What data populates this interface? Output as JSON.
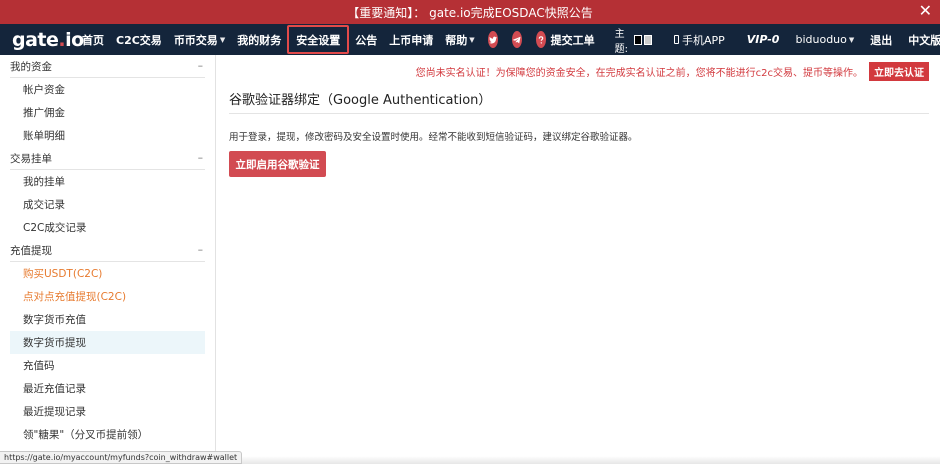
{
  "notice": {
    "text": "【重要通知】：  gate.io完成EOSDAC快照公告",
    "close": "✕"
  },
  "navbar": {
    "logo_main": "gate",
    "logo_dot": ".",
    "logo_tail": "io",
    "items": [
      {
        "label": "首页"
      },
      {
        "label": "C2C交易"
      },
      {
        "label": "币币交易",
        "dropdown": true
      },
      {
        "label": "我的财务"
      },
      {
        "label": "安全设置",
        "active": true
      },
      {
        "label": "公告"
      },
      {
        "label": "上币申请"
      },
      {
        "label": "帮助",
        "dropdown": true
      }
    ],
    "ticket": "提交工单",
    "theme_label": "主题:",
    "mobile_app": "手机APP",
    "vip": "VIP-0",
    "username": "biduoduo",
    "logout": "退出",
    "language": "中文版",
    "chevron": "▼",
    "accent": "#d24b52",
    "bg": "#14253b"
  },
  "sidebar": {
    "groups": [
      {
        "title": "我的资金",
        "toggle": "–",
        "items": [
          {
            "label": "帐户资金"
          },
          {
            "label": "推广佣金"
          },
          {
            "label": "账单明细"
          }
        ]
      },
      {
        "title": "交易挂单",
        "toggle": "–",
        "items": [
          {
            "label": "我的挂单"
          },
          {
            "label": "成交记录"
          },
          {
            "label": "C2C成交记录"
          }
        ]
      },
      {
        "title": "充值提现",
        "toggle": "–",
        "items": [
          {
            "label": "购买USDT(C2C)",
            "orange": true
          },
          {
            "label": "点对点充值提现(C2C)",
            "orange": true
          },
          {
            "label": "数字货币充值"
          },
          {
            "label": "数字货币提现",
            "selected": true
          },
          {
            "label": "充值码"
          },
          {
            "label": "最近充值记录"
          },
          {
            "label": "最近提现记录"
          },
          {
            "label": "领\"糖果\"（分叉币提前领）"
          }
        ]
      }
    ]
  },
  "main": {
    "warning": "您尚未实名认证！为保障您的资金安全，在完成实名认证之前，您将不能进行c2c交易、提币等操作。",
    "warning_button": "立即去认证",
    "title": "谷歌验证器绑定（Google Authentication）",
    "description": "用于登录，提现，修改密码及安全设置时使用。经常不能收到短信验证码，建议绑定谷歌验证器。",
    "enable_button": "立即启用谷歌验证"
  },
  "statusbar": {
    "url": "https://gate.io/myaccount/myfunds?coin_withdraw#wallet"
  }
}
